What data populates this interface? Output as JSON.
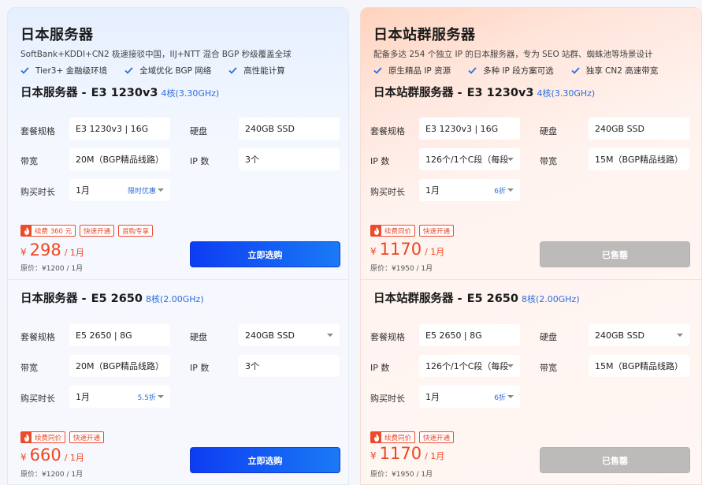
{
  "panels": [
    {
      "title": "日本服务器",
      "desc": "SoftBank+KDDI+CN2 极速接驳中国，IIJ+NTT 混合 BGP 秒级覆盖全球",
      "features": [
        "Tier3+ 金融级环境",
        "全域优化 BGP 网络",
        "高性能计算"
      ],
      "plans": [
        {
          "name": "日本服务器 -",
          "model": "E3 1230v3",
          "cores": "4核(3.30GHz)",
          "spec_label": "套餐规格",
          "spec_value": "E3 1230v3 | 16G",
          "disk_label": "硬盘",
          "disk_value": "240GB SSD",
          "row2_label": "带宽",
          "row2_value": "20M（BGP精品线路）",
          "row2b_label": "IP 数",
          "row2b_value": "3个",
          "duration_label": "购买时长",
          "duration_value": "1月",
          "duration_tag": "限时优惠",
          "badges": [
            "续费 360 元",
            "快速开通",
            "首购专享"
          ],
          "currency": "¥",
          "price": "298",
          "period": "/ 1月",
          "orig_price": "原价：¥1200 / 1月",
          "button": "立即选购"
        },
        {
          "name": "日本服务器 -",
          "model": "E5 2650",
          "cores": "8核(2.00GHz)",
          "spec_label": "套餐规格",
          "spec_value": "E5 2650 | 8G",
          "disk_label": "硬盘",
          "disk_value": "240GB SSD",
          "row2_label": "带宽",
          "row2_value": "20M（BGP精品线路）",
          "row2b_label": "IP 数",
          "row2b_value": "3个",
          "duration_label": "购买时长",
          "duration_value": "1月",
          "duration_tag": "5.5折",
          "badges": [
            "续费同价",
            "快速开通"
          ],
          "currency": "¥",
          "price": "660",
          "period": "/ 1月",
          "orig_price": "原价：¥1200 / 1月",
          "button": "立即选购"
        }
      ]
    },
    {
      "title": "日本站群服务器",
      "desc": "配备多达 254 个独立 IP 的日本服务器，专为 SEO 站群、蜘蛛池等场景设计",
      "features": [
        "原生精品 IP 资源",
        "多种 IP 段方案可选",
        "独享 CN2 高速带宽"
      ],
      "plans": [
        {
          "name": "日本站群服务器 -",
          "model": "E3 1230v3",
          "cores": "4核(3.30GHz)",
          "spec_label": "套餐规格",
          "spec_value": "E3 1230v3 | 16G",
          "disk_label": "硬盘",
          "disk_value": "240GB SSD",
          "row2_label": "IP 数",
          "row2_value": "126个/1个C段（每段",
          "row2b_label": "带宽",
          "row2b_value": "15M（BGP精品线路）",
          "duration_label": "购买时长",
          "duration_value": "1月",
          "duration_tag": "6折",
          "badges": [
            "续费同价",
            "快速开通"
          ],
          "currency": "¥",
          "price": "1170",
          "period": "/ 1月",
          "orig_price": "原价：¥1950 / 1月",
          "button": "已售罄"
        },
        {
          "name": "日本站群服务器 -",
          "model": "E5 2650",
          "cores": "8核(2.00GHz)",
          "spec_label": "套餐规格",
          "spec_value": "E5 2650 | 8G",
          "disk_label": "硬盘",
          "disk_value": "240GB SSD",
          "row2_label": "IP 数",
          "row2_value": "126个/1个C段（每段",
          "row2b_label": "带宽",
          "row2b_value": "15M（BGP精品线路）",
          "duration_label": "购买时长",
          "duration_value": "1月",
          "duration_tag": "6折",
          "badges": [
            "续费同价",
            "快速开通"
          ],
          "currency": "¥",
          "price": "1170",
          "period": "/ 1月",
          "orig_price": "原价：¥1950 / 1月",
          "button": "已售罄"
        }
      ]
    }
  ],
  "colors": {
    "accent_blue": "#1a5cf5",
    "price_red": "#f0461f",
    "badge_red": "#ee4a2c",
    "sold_gray": "#bdbbb9"
  }
}
